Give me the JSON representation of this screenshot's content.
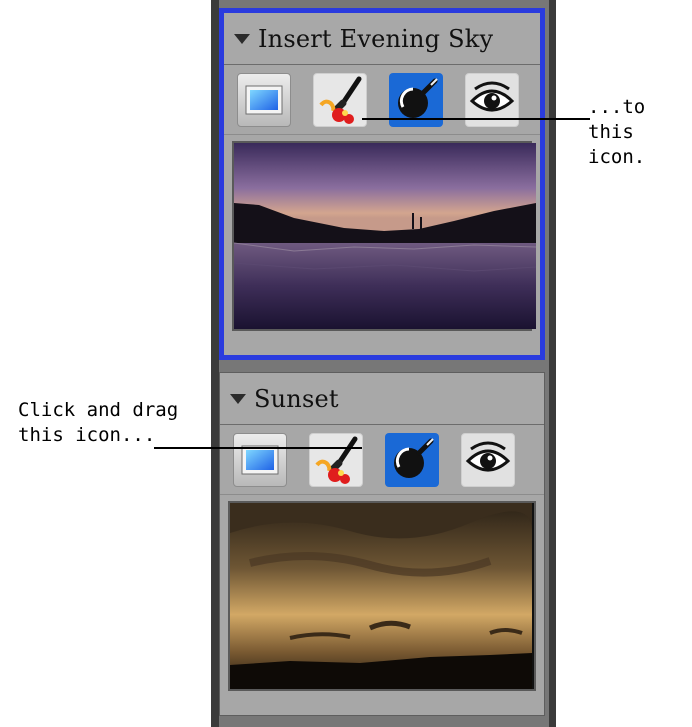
{
  "panels": [
    {
      "title": "Insert Evening Sky",
      "selected": true,
      "tools": [
        "photo-icon",
        "paintbrush-icon",
        "lens-icon",
        "eye-icon"
      ],
      "preview": "evening-lake"
    },
    {
      "title": "Sunset",
      "selected": false,
      "tools": [
        "photo-icon",
        "paintbrush-icon",
        "lens-icon",
        "eye-icon"
      ],
      "preview": "sunset-clouds"
    }
  ],
  "annotations": {
    "target": {
      "line1": "...to this",
      "line2": "icon."
    },
    "source": {
      "line1": "Click and drag",
      "line2": "this icon..."
    }
  },
  "colors": {
    "selection_border": "#2a3bde",
    "lens_button": "#1a69d6"
  }
}
